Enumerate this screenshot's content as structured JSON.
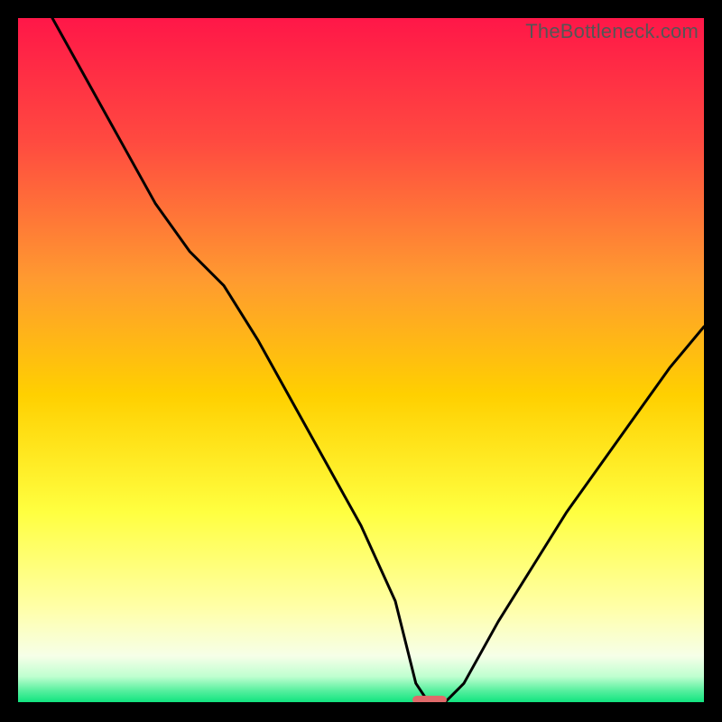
{
  "watermark": "TheBottleneck.com",
  "colors": {
    "gradient_top": "#ff1748",
    "gradient_mid_upper": "#ff7a3a",
    "gradient_mid": "#ffd000",
    "gradient_mid_lower": "#ffff58",
    "gradient_lower": "#fafff0",
    "gradient_bottom": "#06e27a",
    "curve": "#000000",
    "axis": "#000000",
    "marker_fill": "#e06a6a",
    "frame_bg": "#000000"
  },
  "chart_data": {
    "type": "line",
    "title": "",
    "xlabel": "",
    "ylabel": "",
    "xlim": [
      0,
      100
    ],
    "ylim": [
      0,
      100
    ],
    "series": [
      {
        "name": "bottleneck-curve",
        "x": [
          5,
          10,
          15,
          20,
          25,
          30,
          35,
          40,
          45,
          50,
          55,
          58,
          60,
          62,
          65,
          70,
          75,
          80,
          85,
          90,
          95,
          100
        ],
        "values": [
          100,
          91,
          82,
          73,
          66,
          61,
          53,
          44,
          35,
          26,
          15,
          3,
          0,
          0,
          3,
          12,
          20,
          28,
          35,
          42,
          49,
          55
        ]
      }
    ],
    "marker": {
      "x": 60,
      "y": 0,
      "width": 5,
      "height": 1.2
    }
  }
}
